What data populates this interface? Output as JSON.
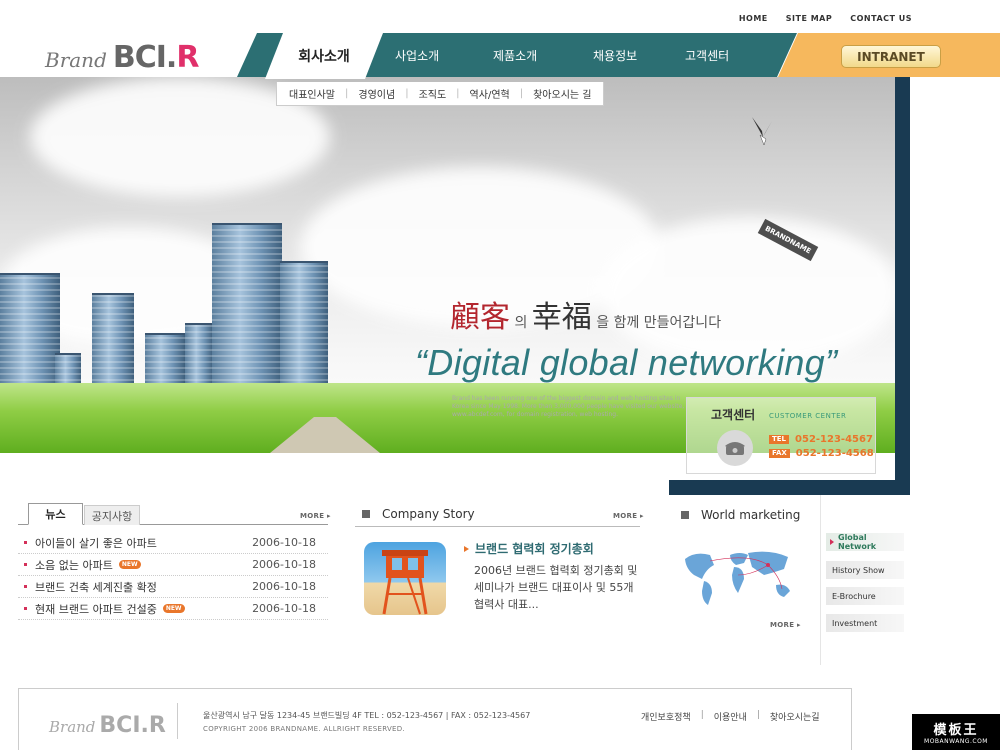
{
  "util_links": [
    "HOME",
    "SITE MAP",
    "CONTACT US"
  ],
  "logo": {
    "brand": "Brand",
    "mark_a": "BCI.",
    "mark_b": "R"
  },
  "nav": {
    "active": "회사소개",
    "items": [
      "사업소개",
      "제품소개",
      "채용정보",
      "고객센터"
    ],
    "intranet": "INTRANET"
  },
  "subnav": [
    "대표인사말",
    "경영이념",
    "조직도",
    "역사/연혁",
    "찾아오시는 길"
  ],
  "hero": {
    "title_a": "顧客",
    "title_mid": "의",
    "title_b": "幸福",
    "title_end": "을 함께 만들어갑니다",
    "slogan": "“Digital global networking”",
    "blurb": "Brand has been running one of the biggest domain and web hosting sites in Korea since May 1998. More than 3,000,000 people have visited our website, www.abcdef.com, for domain registration, web hosting.",
    "tag": "BRANDNAME"
  },
  "customer_center": {
    "title": "고객센터",
    "subtitle": "CUSTOMER CENTER",
    "tel_label": "TEL",
    "tel": "052-123-4567",
    "fax_label": "FAX",
    "fax": "052-123-4568"
  },
  "news": {
    "tabs": [
      "뉴스",
      "공지사항"
    ],
    "more": "MORE ▸",
    "items": [
      {
        "title": "아이들이 살기 좋은 아파트",
        "date": "2006-10-18",
        "is_new": false
      },
      {
        "title": "소음 없는 아파트",
        "date": "2006-10-18",
        "is_new": true
      },
      {
        "title": "브랜드 건축 세계진출 확정",
        "date": "2006-10-18",
        "is_new": false
      },
      {
        "title": "현재 브랜드 아파트 건설중",
        "date": "2006-10-18",
        "is_new": true
      }
    ],
    "new_badge": "NEW"
  },
  "story": {
    "heading": "Company Story",
    "more": "MORE ▸",
    "title": "브랜드 협력회 정기총회",
    "text": "2006년 브랜드 협력회 정기총회 및 세미나가 브랜드 대표이사 및 55개 협력사 대표..."
  },
  "world": {
    "heading": "World marketing",
    "more": "MORE ▸"
  },
  "side_menu": [
    "Global Network",
    "History Show",
    "E-Brochure",
    "Investment"
  ],
  "footer": {
    "logo_brand": "Brand",
    "logo_mark": "BCI.R",
    "address": "울산광역시 남구 달동 1234-45 브랜드빌딩 4F     TEL : 052-123-4567   |   FAX : 052-123-4567",
    "copyright": "COPYRIGHT 2006 BRANDNAME. ALLRIGHT RESERVED.",
    "links": [
      "개인보호정책",
      "이용안내",
      "찾아오시는길"
    ]
  },
  "watermark": {
    "line1": "模板王",
    "line2": "MOBANWANG.COM"
  },
  "colors": {
    "teal": "#2c6f73",
    "orange": "#f6b85d",
    "accent": "#e0306a",
    "navy": "#193a52"
  }
}
